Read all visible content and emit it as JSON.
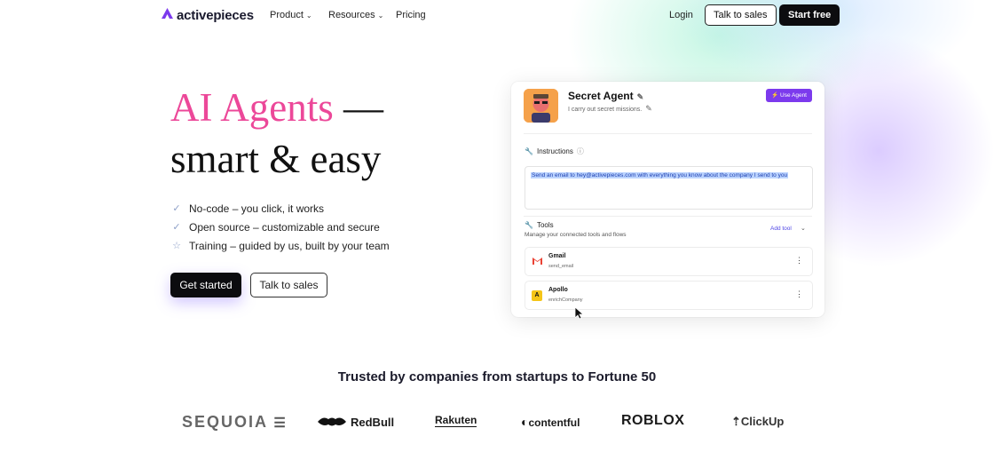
{
  "nav": {
    "brand": "activepieces",
    "links": [
      {
        "label": "Product",
        "has_dropdown": true
      },
      {
        "label": "Resources",
        "has_dropdown": true
      },
      {
        "label": "Pricing",
        "has_dropdown": false
      }
    ],
    "login": "Login",
    "talk_to_sales": "Talk to sales",
    "start_free": "Start free"
  },
  "hero": {
    "title_highlight": "AI Agents",
    "title_dash": " —",
    "title_line2": "smart & easy",
    "features": [
      {
        "icon": "check-icon",
        "text": "No-code – you click, it works"
      },
      {
        "icon": "check-icon",
        "text": "Open source – customizable and secure"
      },
      {
        "icon": "star-icon",
        "text": "Training – guided by us, built by your team"
      }
    ],
    "cta_primary": "Get started",
    "cta_secondary": "Talk to sales"
  },
  "agent_card": {
    "name": "Secret Agent",
    "description": "I carry out secret missions.",
    "use_agent": "Use Agent",
    "instructions_label": "Instructions",
    "instructions_text": "Send an email to hey@activepieces.com with everything you know about the company I send to you",
    "tools_label": "Tools",
    "tools_sub": "Manage your connected tools and flows",
    "add_tool": "Add tool",
    "tools": [
      {
        "name": "Gmail",
        "action": "send_email",
        "icon": "gmail-icon"
      },
      {
        "name": "Apollo",
        "action": "enrichCompany",
        "icon": "apollo-icon"
      }
    ]
  },
  "trusted": {
    "heading": "Trusted by companies from startups to Fortune 50",
    "logos": [
      "SEQUOIA",
      "RedBull",
      "Rakuten",
      "contentful",
      "ROBLOX",
      "ClickUp"
    ]
  },
  "colors": {
    "accent_pink": "#ec4899",
    "accent_purple": "#7c3aed",
    "dark": "#0c0c0f"
  }
}
